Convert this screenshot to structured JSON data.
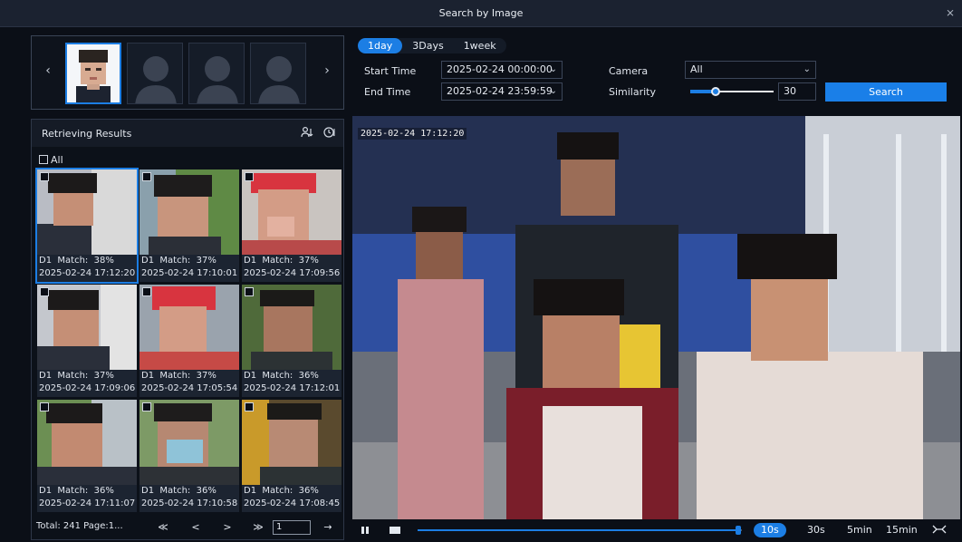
{
  "window": {
    "title": "Search by Image",
    "close_icon": "close-icon"
  },
  "reference": {
    "prev_glyph": "‹",
    "next_glyph": "›"
  },
  "range_tabs": [
    "1day",
    "3Days",
    "1week"
  ],
  "range_selected": "1day",
  "form": {
    "start_time_label": "Start Time",
    "start_time_value": "2025-02-24 00:00:00",
    "end_time_label": "End Time",
    "end_time_value": "2025-02-24 23:59:59",
    "camera_label": "Camera",
    "camera_value": "All",
    "similarity_label": "Similarity",
    "similarity_value": "30",
    "similarity_fraction": 0.3,
    "search_label": "Search"
  },
  "results": {
    "title": "Retrieving Results",
    "all_label": "All",
    "items": [
      {
        "l1": "D1  Match:  38%",
        "l2": "2025-02-24 17:12:20"
      },
      {
        "l1": "D1  Match:  37%",
        "l2": "2025-02-24 17:10:01"
      },
      {
        "l1": "D1  Match:  37%",
        "l2": "2025-02-24 17:09:56"
      },
      {
        "l1": "D1  Match:  37%",
        "l2": "2025-02-24 17:09:06"
      },
      {
        "l1": "D1  Match:  37%",
        "l2": "2025-02-24 17:05:54"
      },
      {
        "l1": "D1  Match:  36%",
        "l2": "2025-02-24 17:12:01"
      },
      {
        "l1": "D1  Match:  36%",
        "l2": "2025-02-24 17:11:07"
      },
      {
        "l1": "D1  Match:  36%",
        "l2": "2025-02-24 17:10:58"
      },
      {
        "l1": "D1  Match:  36%",
        "l2": "2025-02-24 17:08:45"
      }
    ],
    "total_text": "Total: 241  Page:1...",
    "page_input": "1",
    "pager_glyphs": {
      "first": "≪",
      "prev": "<",
      "next": ">",
      "last": "≫",
      "go": "→"
    }
  },
  "video": {
    "osd_text": "2025-02-24 17:12:20",
    "playback_fraction": 0.99,
    "time_buttons": [
      "10s",
      "30s",
      "5min",
      "15min"
    ],
    "time_selected": "10s"
  }
}
